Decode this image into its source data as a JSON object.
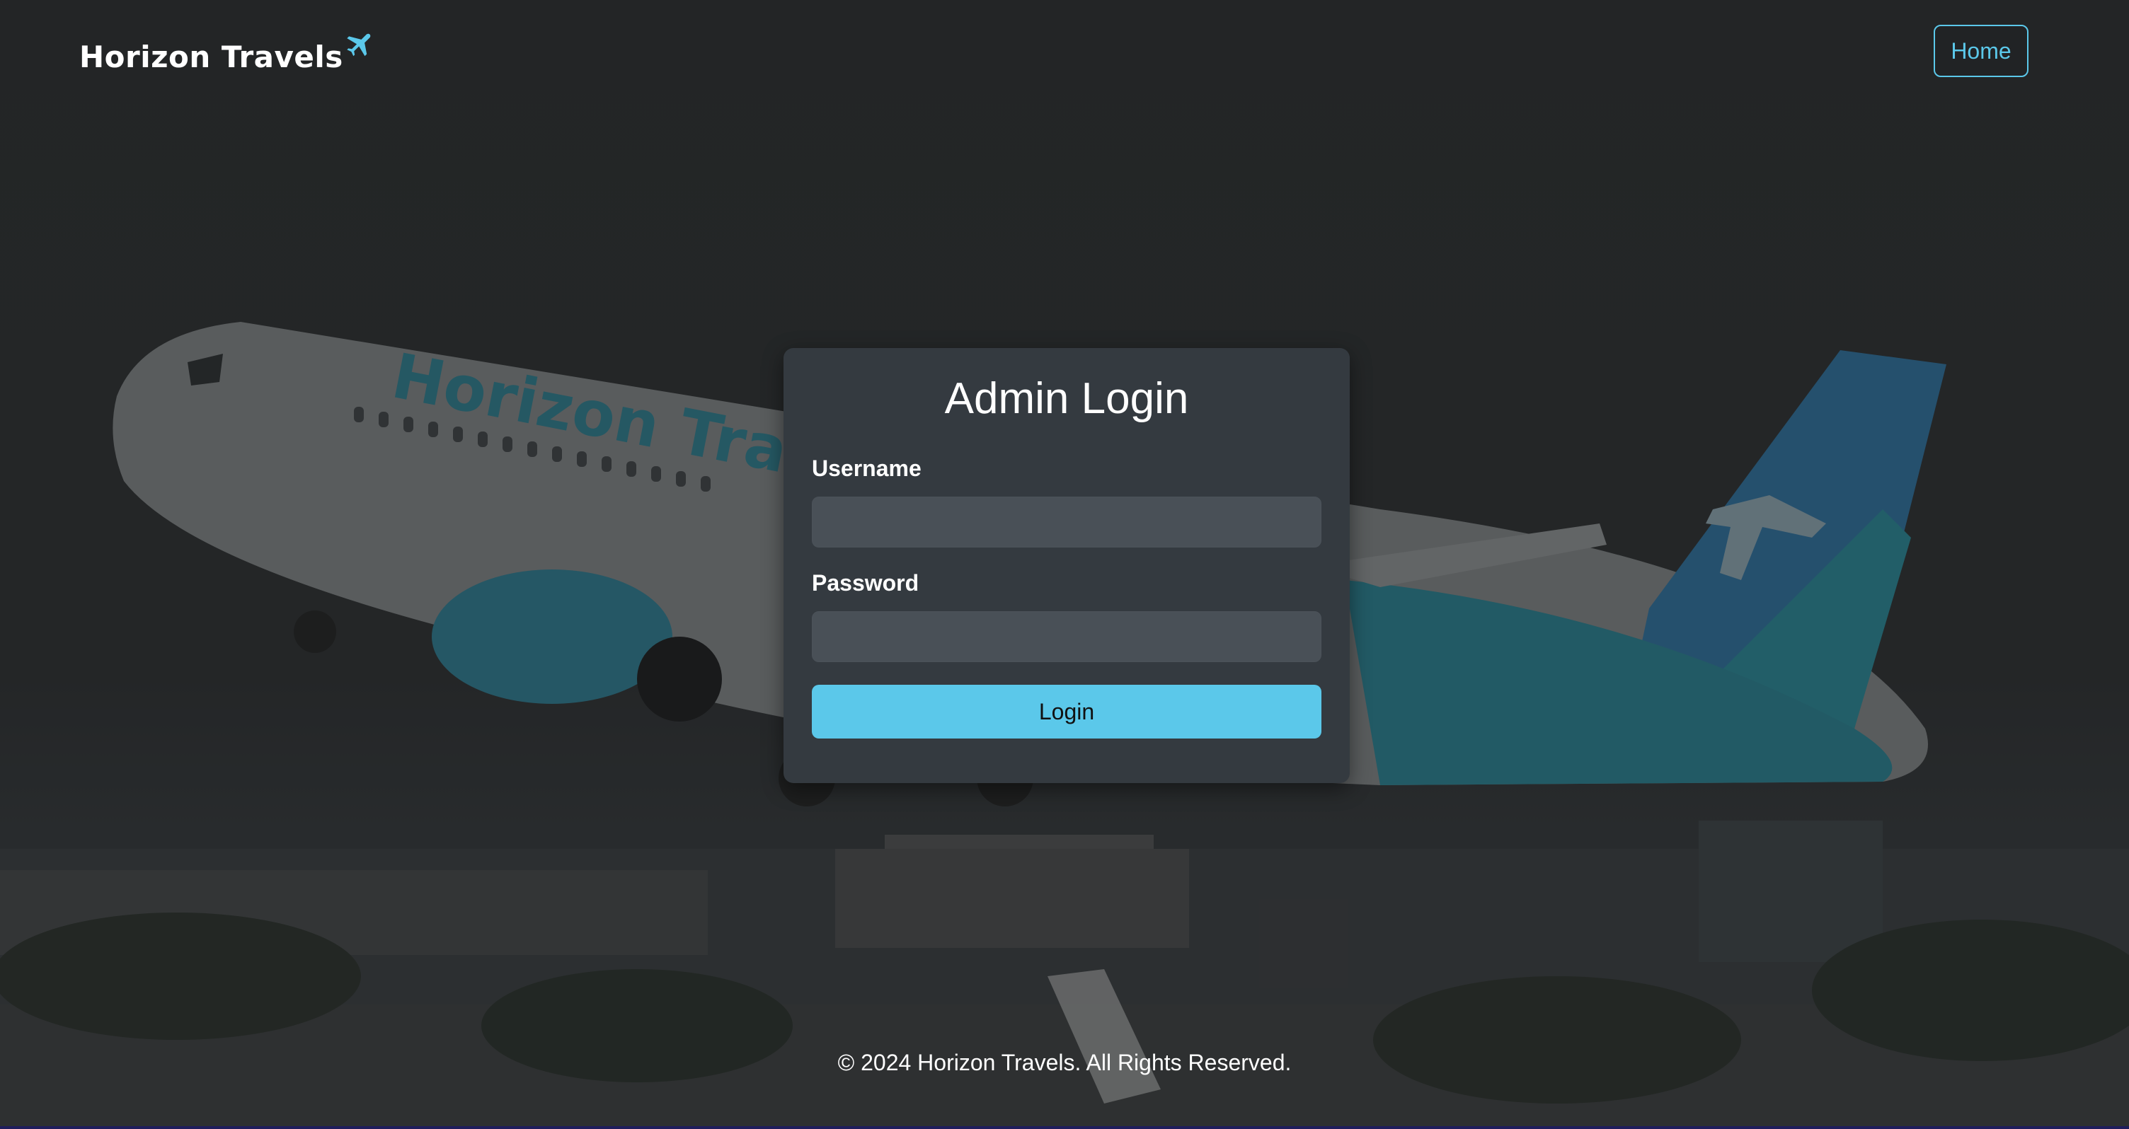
{
  "header": {
    "brand_name": "Horizon Travels",
    "brand_icon": "airplane-icon",
    "nav_home_label": "Home"
  },
  "login_card": {
    "title": "Admin Login",
    "username_label": "Username",
    "username_value": "",
    "password_label": "Password",
    "password_value": "",
    "submit_label": "Login"
  },
  "background": {
    "aircraft_livery_text": "Horizon Travels"
  },
  "footer": {
    "copyright": "© 2024 Horizon Travels. All Rights Reserved."
  },
  "colors": {
    "accent": "#5bc8ea",
    "card_background": "#343a40",
    "input_background": "#495057",
    "page_background": "#2b2d30"
  }
}
